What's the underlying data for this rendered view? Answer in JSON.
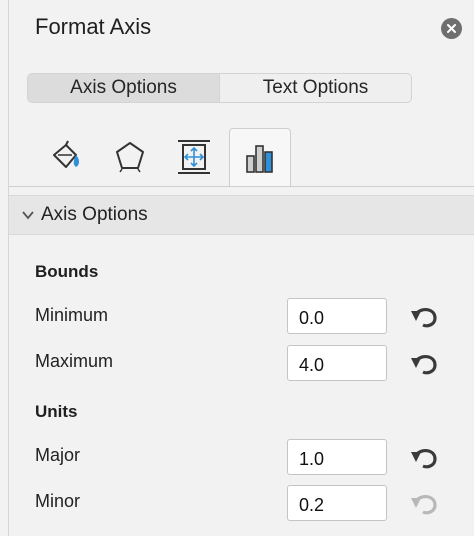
{
  "panel": {
    "title": "Format Axis",
    "close_icon": "close-icon"
  },
  "tabs": [
    {
      "label": "Axis Options",
      "active": true
    },
    {
      "label": "Text Options",
      "active": false
    }
  ],
  "icon_tabs": [
    {
      "icon": "fill-line-icon",
      "active": false
    },
    {
      "icon": "effects-pentagon-icon",
      "active": false
    },
    {
      "icon": "size-properties-icon",
      "active": false
    },
    {
      "icon": "axis-options-chart-icon",
      "active": true
    }
  ],
  "section": {
    "label": "Axis Options",
    "expanded": true
  },
  "bounds": {
    "title": "Bounds",
    "minimum": {
      "label": "Minimum",
      "value": "0.0",
      "reset_enabled": true
    },
    "maximum": {
      "label": "Maximum",
      "value": "4.0",
      "reset_enabled": true
    }
  },
  "units": {
    "title": "Units",
    "major": {
      "label": "Major",
      "value": "1.0",
      "reset_enabled": true
    },
    "minor": {
      "label": "Minor",
      "value": "0.2",
      "reset_enabled": false
    }
  },
  "colors": {
    "reset_enabled": "#3a3a3a",
    "reset_disabled": "#b8b8b8",
    "accent_blue": "#2f8fd8"
  }
}
